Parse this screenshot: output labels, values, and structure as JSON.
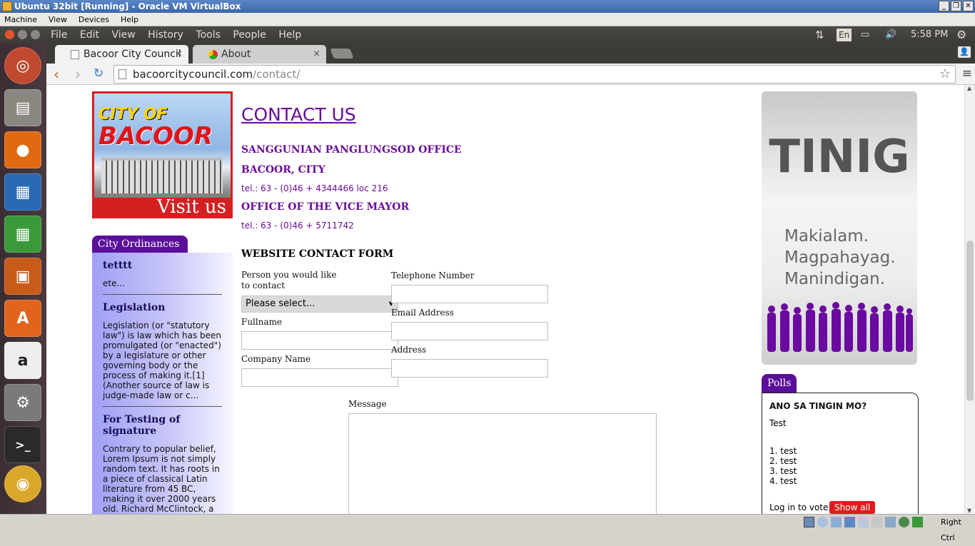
{
  "vb": {
    "title": "Ubuntu 32bit [Running] - Oracle VM VirtualBox",
    "menu": [
      "Machine",
      "View",
      "Devices",
      "Help"
    ],
    "host_key": "Right Ctrl"
  },
  "ubuntu": {
    "menu": [
      "File",
      "Edit",
      "View",
      "History",
      "Tools",
      "People",
      "Help"
    ],
    "keyboard": "En",
    "clock": "5:58 PM"
  },
  "browser": {
    "tabs": [
      {
        "label": "Bacoor City Council",
        "close": "×"
      },
      {
        "label": "About",
        "close": "×"
      }
    ],
    "url_host": "bacoorcitycouncil.com",
    "url_path": "/contact/"
  },
  "page": {
    "banner": {
      "logo_top": "CITY OF",
      "logo_main": "BACOOR",
      "visit": "Visit us"
    },
    "ordinances": {
      "tab": "City Ordinances",
      "items": [
        {
          "title": "tetttt",
          "body": "ete..."
        },
        {
          "title": "Legislation",
          "body": "Legislation (or \"statutory law\") is law which has been promulgated (or \"enacted\") by a legislature or other governing body or the process of making it.[1] (Another source of law is judge-made law or c..."
        },
        {
          "title": "For Testing of signature",
          "body": "Contrary to popular belief, Lorem Ipsum is not simply random text. It has roots in a piece of classical Latin literature from 45 BC, making it over 2000 years old. Richard McClintock, a Latin professo..."
        }
      ]
    },
    "contact": {
      "heading": "CONTACT US",
      "office1": "SANGGUNIAN PANGLUNGSOD OFFICE",
      "city": "BACOOR, CITY",
      "tel1": "tel.: 63 - (0)46 + 4344466 loc 216",
      "office2": "OFFICE OF THE VICE MAYOR",
      "tel2": "tel.: 63 - (0)46 + 5711742"
    },
    "form": {
      "heading": "WEBSITE CONTACT FORM",
      "person_label": "Person you would like to contact",
      "person_value": "Please select...",
      "fullname_label": "Fullname",
      "company_label": "Company Name",
      "phone_label": "Telephone Number",
      "email_label": "Email Address",
      "address_label": "Address",
      "message_label": "Message"
    },
    "tinig": {
      "title": "TINIG",
      "slogan1": "Makialam.",
      "slogan2": "Magpahayag.",
      "slogan3": "Manindigan."
    },
    "polls": {
      "tab": "Polls",
      "question": "ANO SA TINGIN MO?",
      "text": "Test",
      "options": [
        "1. test",
        "2. test",
        "3. test",
        "4. test"
      ],
      "login": "Log in to vote.",
      "show_all": "Show all"
    }
  }
}
